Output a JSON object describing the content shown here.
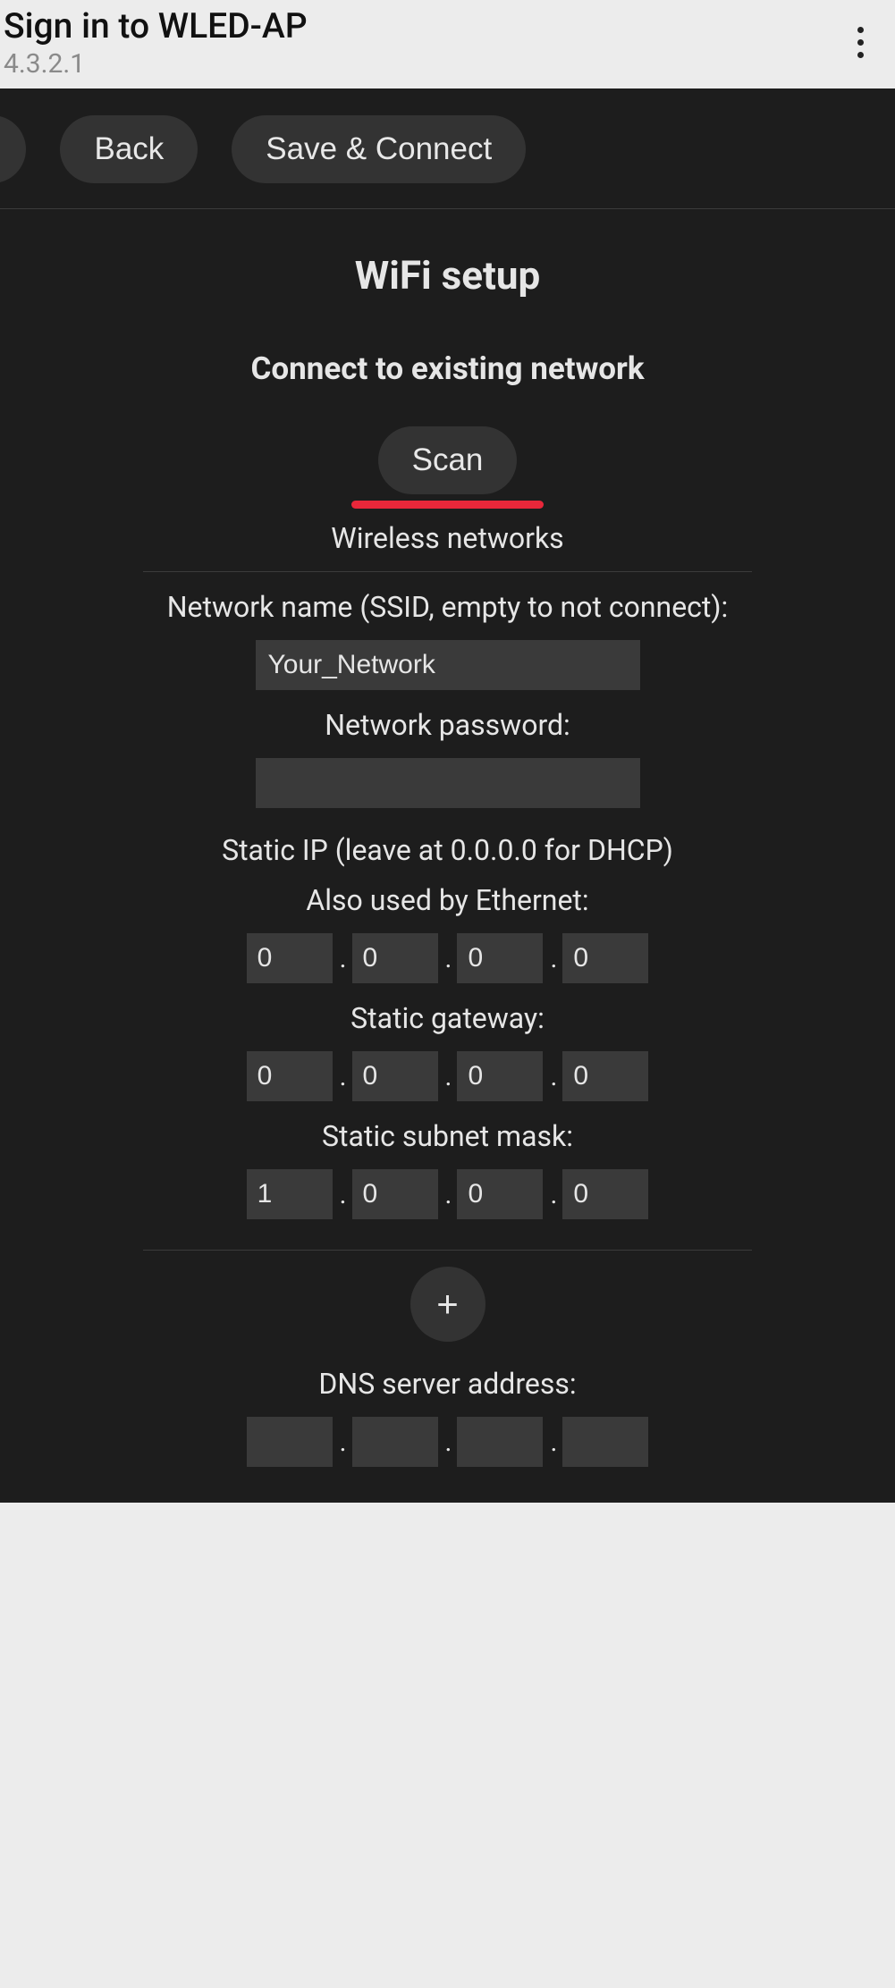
{
  "sysbar": {
    "title": "Sign in to WLED-AP",
    "subtitle": "4.3.2.1"
  },
  "topbar": {
    "help": "?",
    "back": "Back",
    "save": "Save & Connect"
  },
  "page": {
    "title": "WiFi setup",
    "connect_heading": "Connect to existing network",
    "scan_label": "Scan",
    "wireless_label": "Wireless networks",
    "ssid_label": "Network name (SSID, empty to not connect):",
    "ssid_value": "Your_Network",
    "password_label": "Network password:",
    "password_value": "",
    "static_ip_label": "Static IP (leave at 0.0.0.0 for DHCP)",
    "ethernet_label": "Also used by Ethernet:",
    "gateway_label": "Static gateway:",
    "subnet_label": "Static subnet mask:",
    "static_ip": [
      "0",
      "0",
      "0",
      "0"
    ],
    "gateway": [
      "0",
      "0",
      "0",
      "0"
    ],
    "subnet": [
      "1",
      "0",
      "0",
      "0"
    ],
    "add_label": "+",
    "dns_label": "DNS server address:"
  }
}
